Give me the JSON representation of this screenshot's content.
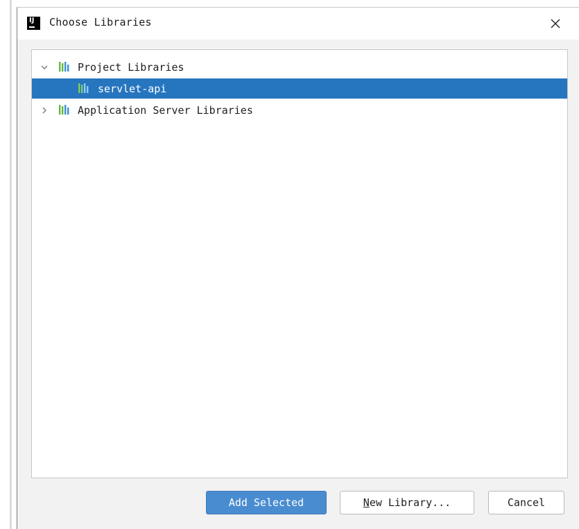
{
  "window": {
    "title": "Choose Libraries",
    "app_icon": "intellij-idea-icon",
    "close_icon": "close-icon"
  },
  "tree": {
    "items": [
      {
        "label": "Project Libraries",
        "expanded": true,
        "icon": "library-icon",
        "children": [
          {
            "label": "servlet-api",
            "selected": true,
            "icon": "library-icon"
          }
        ]
      },
      {
        "label": "Application Server Libraries",
        "expanded": false,
        "icon": "library-icon"
      }
    ]
  },
  "buttons": {
    "add_selected": "Add Selected",
    "new_library_mnemonic": "N",
    "new_library_rest": "ew Library...",
    "cancel": "Cancel"
  },
  "colors": {
    "selection": "#2675bf",
    "primary_button": "#4a8cd0",
    "library_icon_green": "#62b543",
    "library_icon_blue": "#3a8fd6"
  }
}
